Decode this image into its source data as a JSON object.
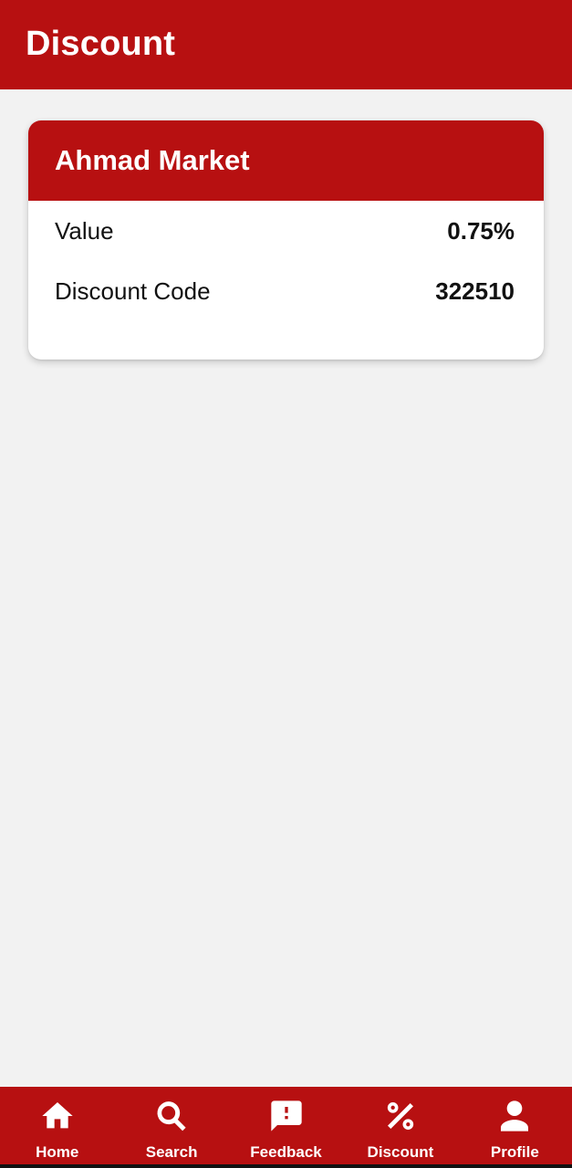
{
  "app_bar": {
    "title": "Discount"
  },
  "card": {
    "store_name": "Ahmad Market",
    "rows": [
      {
        "label": "Value",
        "value": "0.75%"
      },
      {
        "label": "Discount Code",
        "value": "322510"
      }
    ]
  },
  "bottom_nav": {
    "items": [
      {
        "label": "Home",
        "icon": "home-icon"
      },
      {
        "label": "Search",
        "icon": "search-icon"
      },
      {
        "label": "Feedback",
        "icon": "feedback-icon"
      },
      {
        "label": "Discount",
        "icon": "percent-icon"
      },
      {
        "label": "Profile",
        "icon": "person-icon"
      }
    ]
  },
  "colors": {
    "primary": "#b71011",
    "background": "#f2f2f2",
    "card": "#ffffff",
    "text": "#111111"
  }
}
